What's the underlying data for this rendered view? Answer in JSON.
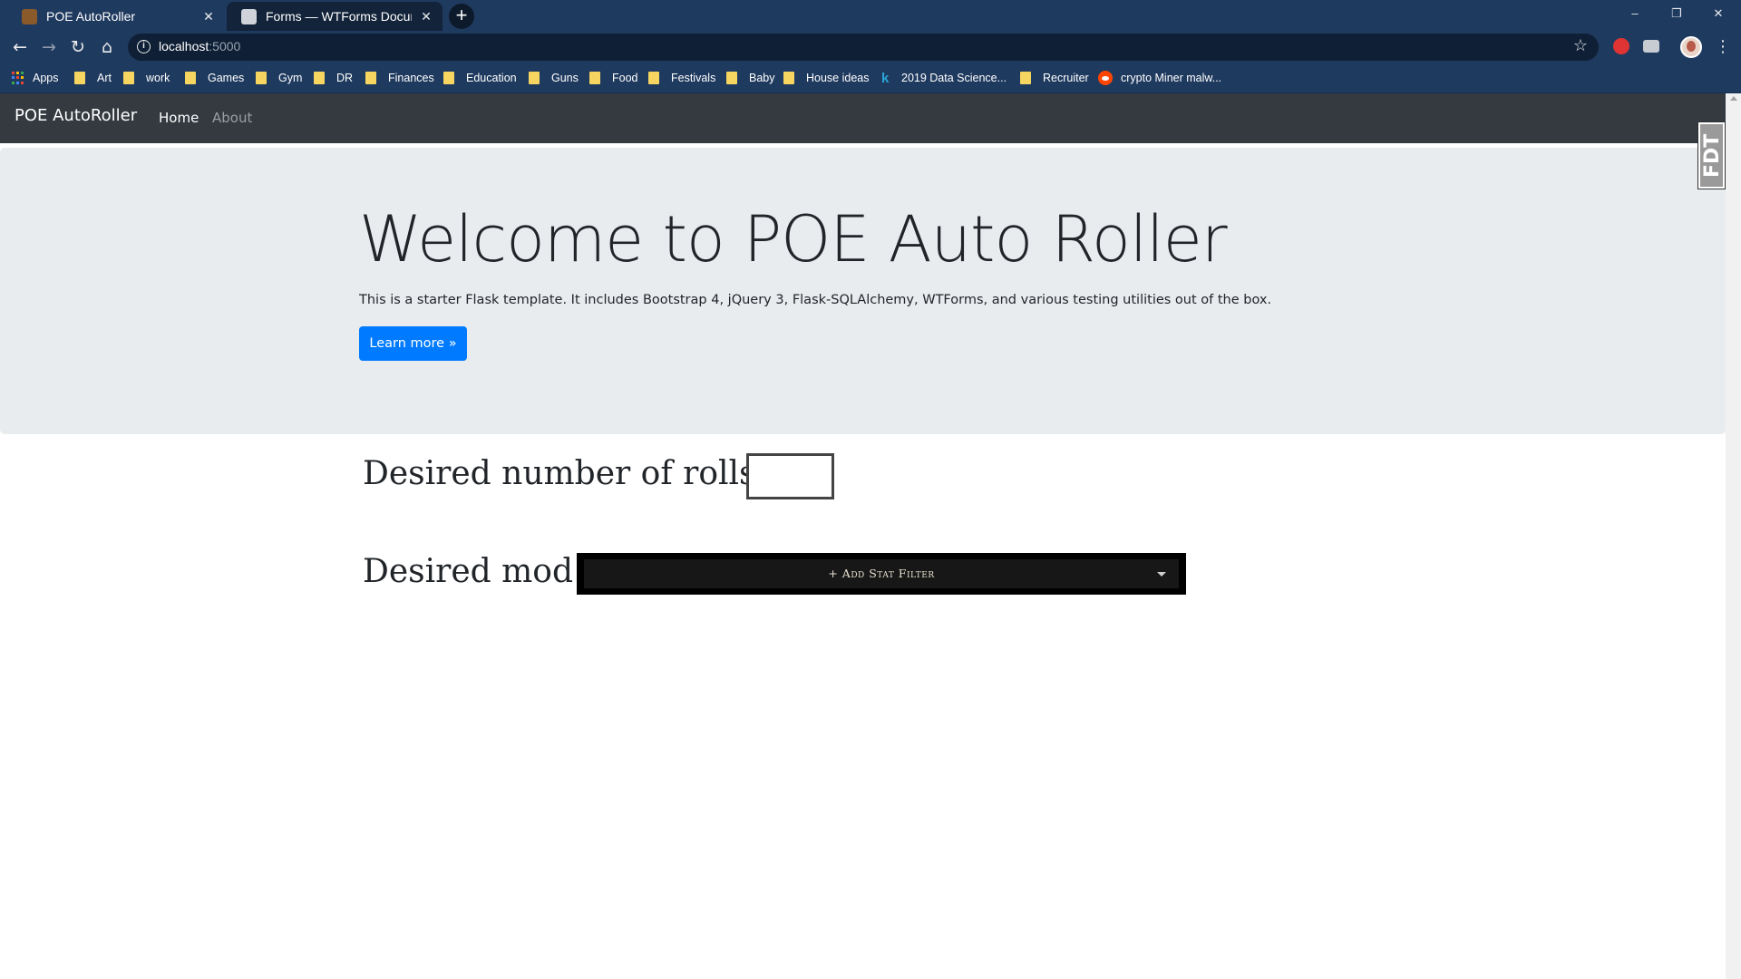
{
  "browser": {
    "tabs": [
      {
        "title": "POE AutoRoller",
        "active": true
      },
      {
        "title": "Forms — WTForms Documentation",
        "active": false
      }
    ],
    "new_tab_symbol": "+",
    "window_controls": [
      "–",
      "❐",
      "✕"
    ],
    "url_host": "localhost",
    "url_port": ":5000",
    "bookmarks": [
      {
        "label": "Apps",
        "icon": "apps-icon"
      },
      {
        "label": "Art",
        "icon": "folder-icon"
      },
      {
        "label": "work",
        "icon": "folder-icon"
      },
      {
        "label": "Games",
        "icon": "folder-icon"
      },
      {
        "label": "Gym",
        "icon": "folder-icon"
      },
      {
        "label": "DR",
        "icon": "folder-icon"
      },
      {
        "label": "Finances",
        "icon": "folder-icon"
      },
      {
        "label": "Education",
        "icon": "folder-icon"
      },
      {
        "label": "Guns",
        "icon": "folder-icon"
      },
      {
        "label": "Food",
        "icon": "folder-icon"
      },
      {
        "label": "Festivals",
        "icon": "folder-icon"
      },
      {
        "label": "Baby",
        "icon": "folder-icon"
      },
      {
        "label": "House ideas",
        "icon": "folder-icon"
      },
      {
        "label": "2019 Data Science...",
        "icon": "kaggle-icon"
      },
      {
        "label": "Recruiter",
        "icon": "folder-icon"
      },
      {
        "label": "crypto Miner malw...",
        "icon": "reddit-icon"
      }
    ],
    "colors": {
      "chrome": "#1f3a5f",
      "folder": "#f7d561"
    }
  },
  "page": {
    "navbar": {
      "brand": "POE AutoRoller",
      "links": [
        {
          "label": "Home",
          "active": true
        },
        {
          "label": "About",
          "active": false
        }
      ]
    },
    "jumbotron": {
      "title": "Welcome to POE Auto Roller",
      "text": "This is a starter Flask template. It includes Bootstrap 4, jQuery 3, Flask-SQLAlchemy, WTForms, and various testing utilities out of the box.",
      "button": "Learn more »"
    },
    "form": {
      "rolls_label": "Desired number of rolls",
      "rolls_value": "",
      "mod_label": "Desired mod",
      "stat_filter_label": "+ Add Stat Filter"
    },
    "side_tab": "FDT",
    "colors": {
      "navbar": "#343a40",
      "jumbotron": "#e9ecef",
      "primary": "#007bff"
    }
  }
}
